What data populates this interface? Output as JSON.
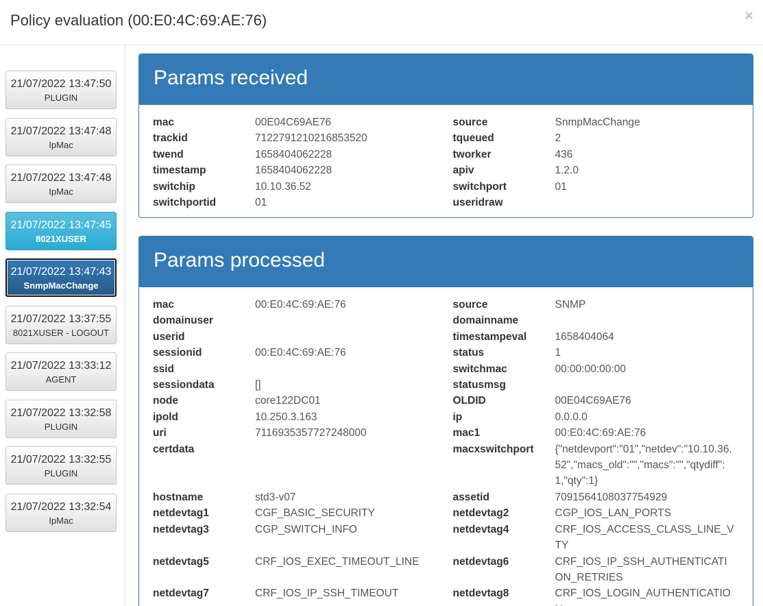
{
  "modal": {
    "title": "Policy evaluation (00:E0:4C:69:AE:76)",
    "close_label": "×"
  },
  "events": [
    {
      "date": "21/07/2022 13:47:50",
      "type": "PLUGIN",
      "state": "default"
    },
    {
      "date": "21/07/2022 13:47:48",
      "type": "IpMac",
      "state": "default"
    },
    {
      "date": "21/07/2022 13:47:48",
      "type": "IpMac",
      "state": "default"
    },
    {
      "date": "21/07/2022 13:47:45",
      "type": "8021XUSER",
      "state": "info"
    },
    {
      "date": "21/07/2022 13:47:43",
      "type": "SnmpMacChange",
      "state": "selected"
    },
    {
      "date": "21/07/2022 13:37:55",
      "type": "8021XUSER - LOGOUT",
      "state": "default"
    },
    {
      "date": "21/07/2022 13:33:12",
      "type": "AGENT",
      "state": "default"
    },
    {
      "date": "21/07/2022 13:32:58",
      "type": "PLUGIN",
      "state": "default"
    },
    {
      "date": "21/07/2022 13:32:55",
      "type": "PLUGIN",
      "state": "default"
    },
    {
      "date": "21/07/2022 13:32:54",
      "type": "IpMac",
      "state": "default"
    }
  ],
  "received": {
    "title": "Params received",
    "rows": [
      [
        [
          "mac",
          "00E04C69AE76"
        ],
        [
          "source",
          "SnmpMacChange"
        ]
      ],
      [
        [
          "trackid",
          "7122791210216853520"
        ],
        [
          "tqueued",
          "2"
        ]
      ],
      [
        [
          "twend",
          "1658404062228"
        ],
        [
          "tworker",
          "436"
        ]
      ],
      [
        [
          "timestamp",
          "1658404062228"
        ],
        [
          "apiv",
          "1.2.0"
        ]
      ],
      [
        [
          "switchip",
          "10.10.36.52"
        ],
        [
          "switchport",
          "01"
        ]
      ],
      [
        [
          "switchportid",
          "01"
        ],
        [
          "useridraw",
          ""
        ]
      ]
    ]
  },
  "processed": {
    "title": "Params processed",
    "rows": [
      [
        [
          "mac",
          "00:E0:4C:69:AE:76"
        ],
        [
          "source",
          "SNMP"
        ]
      ],
      [
        [
          "domainuser",
          ""
        ],
        [
          "domainname",
          ""
        ]
      ],
      [
        [
          "userid",
          ""
        ],
        [
          "timestampeval",
          "1658404064"
        ]
      ],
      [
        [
          "sessionid",
          "00:E0:4C:69:AE:76"
        ],
        [
          "status",
          "1"
        ]
      ],
      [
        [
          "ssid",
          ""
        ],
        [
          "switchmac",
          "00:00:00:00:00"
        ]
      ],
      [
        [
          "sessiondata",
          "[]"
        ],
        [
          "statusmsg",
          ""
        ]
      ],
      [
        [
          "node",
          "core122DC01"
        ],
        [
          "OLDID",
          "00E04C69AE76"
        ]
      ],
      [
        [
          "ipold",
          "10.250.3.163"
        ],
        [
          "ip",
          "0.0.0.0"
        ]
      ],
      [
        [
          "uri",
          "7116935357727248000"
        ],
        [
          "mac1",
          "00:E0:4C:69:AE:76"
        ]
      ],
      [
        [
          "certdata",
          ""
        ],
        [
          "macxswitchport",
          "{\"netdevport\":\"01\",\"netdev\":\"10.10.36.52\",\"macs_old\":\"\",\"macs\":\"\",\"qtydiff\":1,\"qty\":1}"
        ]
      ],
      [
        [
          "hostname",
          "std3-v07"
        ],
        [
          "assetid",
          "7091564108037754929"
        ]
      ],
      [
        [
          "netdevtag1",
          "CGF_BASIC_SECURITY"
        ],
        [
          "netdevtag2",
          "CGP_IOS_LAN_PORTS"
        ]
      ],
      [
        [
          "netdevtag3",
          "CGP_SWITCH_INFO"
        ],
        [
          "netdevtag4",
          "CRF_IOS_ACCESS_CLASS_LINE_VTY"
        ]
      ],
      [
        [
          "netdevtag5",
          "CRF_IOS_EXEC_TIMEOUT_LINE"
        ],
        [
          "netdevtag6",
          "CRF_IOS_IP_SSH_AUTHENTICATION_RETRIES"
        ]
      ],
      [
        [
          "netdevtag7",
          "CRF_IOS_IP_SSH_TIMEOUT"
        ],
        [
          "netdevtag8",
          "CRF_IOS_LOGIN_AUTHENTICATION"
        ]
      ]
    ]
  },
  "colors": {
    "panel_primary": "#337ab7",
    "button_info": "#5bc0de",
    "button_selected": "#265a88"
  }
}
